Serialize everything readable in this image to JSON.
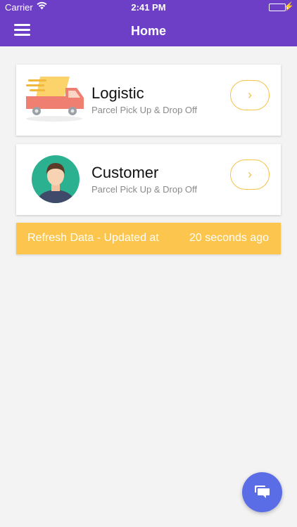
{
  "status_bar": {
    "carrier": "Carrier",
    "time": "2:41 PM",
    "battery_color": "#4cd964"
  },
  "nav": {
    "title": "Home",
    "menu_icon": "hamburger-menu-icon",
    "background": "#6c3fc6"
  },
  "cards": [
    {
      "title": "Logistic",
      "subtitle": "Parcel Pick Up & Drop Off",
      "icon": "delivery-truck-icon",
      "action": "›"
    },
    {
      "title": "Customer",
      "subtitle": "Parcel Pick Up & Drop Off",
      "icon": "customer-avatar-icon",
      "action": "›"
    }
  ],
  "refresh": {
    "label": "Refresh Data - Updated at",
    "updated": "20 seconds ago",
    "color": "#fcc54e"
  },
  "fab": {
    "icon": "chat-icon",
    "color": "#5b6de6"
  }
}
